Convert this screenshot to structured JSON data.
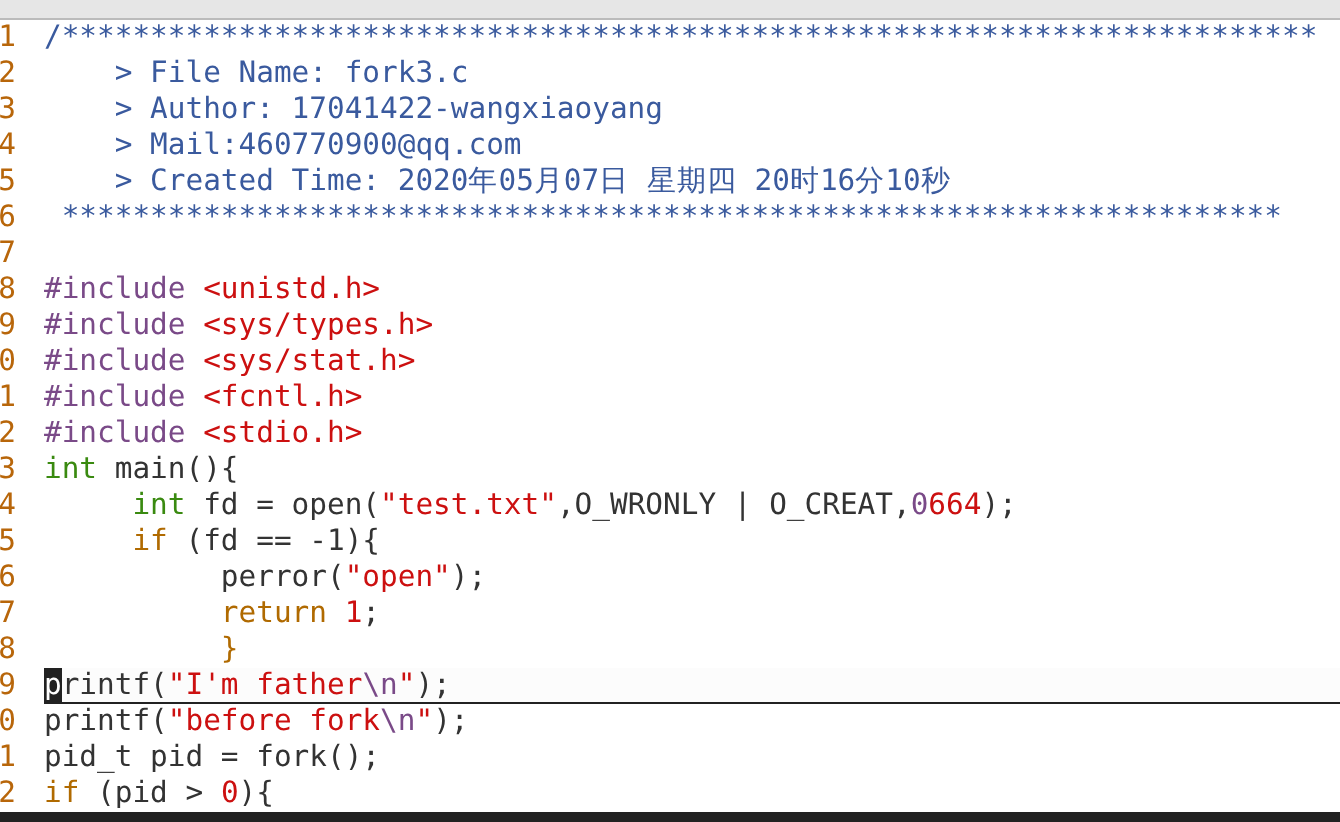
{
  "editor": {
    "lines": [
      {
        "number": "1",
        "segments": [
          {
            "kind": "comment",
            "text": "/***********************************************************************"
          }
        ]
      },
      {
        "number": "2",
        "segments": [
          {
            "kind": "comment",
            "text": "    > File Name: fork3.c"
          }
        ]
      },
      {
        "number": "3",
        "segments": [
          {
            "kind": "comment",
            "text": "    > Author: 17041422-wangxiaoyang"
          }
        ]
      },
      {
        "number": "4",
        "segments": [
          {
            "kind": "comment",
            "text": "    > Mail:460770900@qq.com"
          }
        ]
      },
      {
        "number": "5",
        "segments": [
          {
            "kind": "comment",
            "text": "    > Created Time: 2020年05月07日 星期四 20时16分10秒"
          }
        ]
      },
      {
        "number": "6",
        "segments": [
          {
            "kind": "comment",
            "text": " *********************************************************************"
          }
        ]
      },
      {
        "number": "7"
      },
      {
        "number": "8",
        "segments": [
          {
            "kind": "preproc",
            "text": "#include "
          },
          {
            "kind": "string",
            "text": "<unistd.h>"
          }
        ]
      },
      {
        "number": "9",
        "segments": [
          {
            "kind": "preproc",
            "text": "#include "
          },
          {
            "kind": "string",
            "text": "<sys/types.h>"
          }
        ]
      },
      {
        "number": "0",
        "segments": [
          {
            "kind": "preproc",
            "text": "#include "
          },
          {
            "kind": "string",
            "text": "<sys/stat.h>"
          }
        ]
      },
      {
        "number": "1",
        "segments": [
          {
            "kind": "preproc",
            "text": "#include "
          },
          {
            "kind": "string",
            "text": "<fcntl.h>"
          }
        ]
      },
      {
        "number": "2",
        "segments": [
          {
            "kind": "preproc",
            "text": "#include "
          },
          {
            "kind": "string",
            "text": "<stdio.h>"
          }
        ]
      },
      {
        "number": "3",
        "segments": [
          {
            "kind": "type",
            "text": "int"
          },
          {
            "kind": "plain",
            "text": " main(){"
          }
        ]
      },
      {
        "number": "4",
        "segments": [
          {
            "kind": "type",
            "text": "     int"
          },
          {
            "kind": "plain",
            "text": " fd = open("
          },
          {
            "kind": "string",
            "text": "\"test.txt\""
          },
          {
            "kind": "plain",
            "text": ",O_WRONLY | O_CREAT,"
          },
          {
            "kind": "special",
            "text": "0"
          },
          {
            "kind": "string",
            "text": "664"
          },
          {
            "kind": "plain",
            "text": ");"
          }
        ]
      },
      {
        "number": "5",
        "segments": [
          {
            "kind": "keyword",
            "text": "     if"
          },
          {
            "kind": "plain",
            "text": " (fd == -1){"
          }
        ]
      },
      {
        "number": "6",
        "segments": [
          {
            "kind": "plain",
            "text": "          perror("
          },
          {
            "kind": "string",
            "text": "\"open\""
          },
          {
            "kind": "plain",
            "text": ");"
          }
        ]
      },
      {
        "number": "7",
        "segments": [
          {
            "kind": "keyword",
            "text": "          return "
          },
          {
            "kind": "string",
            "text": "1"
          },
          {
            "kind": "plain",
            "text": ";"
          }
        ]
      },
      {
        "number": "8",
        "segments": [
          {
            "kind": "keyword",
            "text": "          }"
          }
        ]
      },
      {
        "number": "9",
        "cursor_line": true,
        "segments": [
          {
            "kind": "cursor",
            "text": "p"
          },
          {
            "kind": "plain",
            "text": "rintf("
          },
          {
            "kind": "string",
            "text": "\"I'm father"
          },
          {
            "kind": "special",
            "text": "\\n"
          },
          {
            "kind": "string",
            "text": "\""
          },
          {
            "kind": "plain",
            "text": ");"
          }
        ]
      },
      {
        "number": "0",
        "segments": [
          {
            "kind": "plain",
            "text": "printf("
          },
          {
            "kind": "string",
            "text": "\"before fork"
          },
          {
            "kind": "special",
            "text": "\\n"
          },
          {
            "kind": "string",
            "text": "\""
          },
          {
            "kind": "plain",
            "text": ");"
          }
        ]
      },
      {
        "number": "1",
        "segments": [
          {
            "kind": "plain",
            "text": "pid_t pid = fork();"
          }
        ]
      },
      {
        "number": "2",
        "segments": [
          {
            "kind": "keyword",
            "text": "if"
          },
          {
            "kind": "plain",
            "text": " (pid > "
          },
          {
            "kind": "string",
            "text": "0"
          },
          {
            "kind": "plain",
            "text": "){"
          }
        ]
      }
    ]
  }
}
